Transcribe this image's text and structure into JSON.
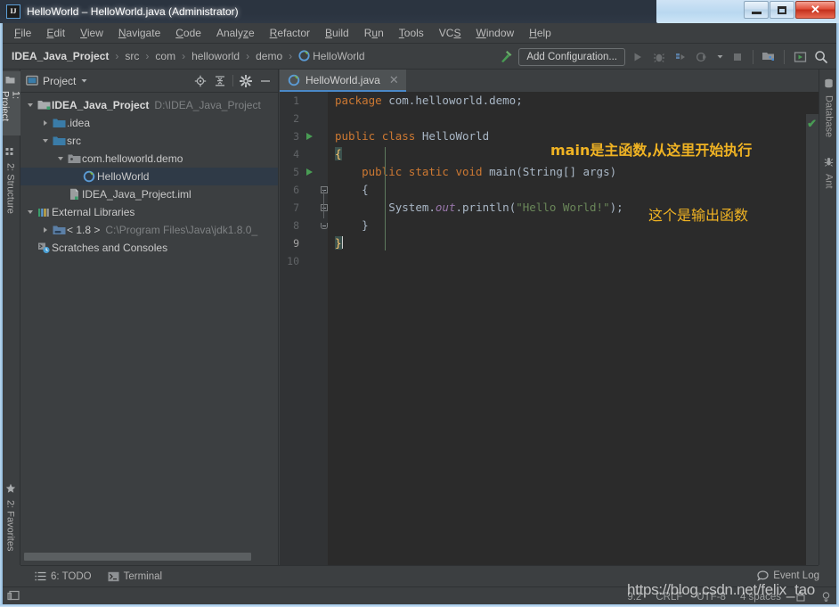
{
  "window": {
    "title": "HelloWorld – HelloWorld.java (Administrator)",
    "logo": "ij-logo",
    "minimize": "minimize-icon",
    "maximize": "maximize-icon",
    "close": "✕"
  },
  "menubar": {
    "items": [
      {
        "label": "File",
        "mnemonic": "F"
      },
      {
        "label": "Edit",
        "mnemonic": "E"
      },
      {
        "label": "View",
        "mnemonic": "V"
      },
      {
        "label": "Navigate",
        "mnemonic": "N"
      },
      {
        "label": "Code",
        "mnemonic": "C"
      },
      {
        "label": "Analyze",
        "mnemonic": "z"
      },
      {
        "label": "Refactor",
        "mnemonic": "R"
      },
      {
        "label": "Build",
        "mnemonic": "B"
      },
      {
        "label": "Run",
        "mnemonic": "u"
      },
      {
        "label": "Tools",
        "mnemonic": "T"
      },
      {
        "label": "VCS",
        "mnemonic": "S"
      },
      {
        "label": "Window",
        "mnemonic": "W"
      },
      {
        "label": "Help",
        "mnemonic": "H"
      }
    ]
  },
  "navbar": {
    "crumbs": [
      {
        "label": "IDEA_Java_Project"
      },
      {
        "label": "src"
      },
      {
        "label": "com"
      },
      {
        "label": "helloworld"
      },
      {
        "label": "demo"
      },
      {
        "label": "HelloWorld"
      }
    ],
    "separator": "›",
    "run_config_label": "Add Configuration...",
    "buttons": [
      "build-hammer-icon",
      "run-icon",
      "debug-icon",
      "run-with-coverage-icon",
      "profile-icon",
      "dropdown-icon",
      "stop-icon",
      "project-structure-icon",
      "update-icon",
      "search-everywhere-icon"
    ]
  },
  "left_strip": {
    "items": [
      {
        "label": "1: Project",
        "icon": "project-icon",
        "active": true
      },
      {
        "label": "2: Structure",
        "icon": "structure-icon",
        "active": false
      },
      {
        "label": "2: Favorites",
        "icon": "star-icon",
        "active": false
      }
    ],
    "bottom_icon": "toggle-toolwindows-icon"
  },
  "right_strip": {
    "items": [
      {
        "label": "Database",
        "icon": "database-icon"
      },
      {
        "label": "Ant",
        "icon": "ant-icon"
      }
    ]
  },
  "project_panel": {
    "title": "Project",
    "title_icon": "project-view-icon",
    "dropdown_icon": "chevron-down-icon",
    "actions": [
      "locate-icon",
      "collapse-all-icon",
      "settings-gear-icon",
      "hide-icon"
    ],
    "tree": [
      {
        "indent": 0,
        "arrow": "open",
        "icon": "module-icon",
        "label": "IDEA_Java_Project",
        "bold": true,
        "sub": "D:\\IDEA_Java_Project",
        "selected": false
      },
      {
        "indent": 1,
        "arrow": "closed",
        "icon": "folder-icon",
        "label": ".idea",
        "bold": false,
        "sub": "",
        "selected": false
      },
      {
        "indent": 1,
        "arrow": "open",
        "icon": "source-folder-icon",
        "label": "src",
        "bold": false,
        "sub": "",
        "selected": false
      },
      {
        "indent": 2,
        "arrow": "open",
        "icon": "package-icon",
        "label": "com.helloworld.demo",
        "bold": false,
        "sub": "",
        "selected": false
      },
      {
        "indent": 3,
        "arrow": "none",
        "icon": "java-class-icon",
        "label": "HelloWorld",
        "bold": false,
        "sub": "",
        "selected": true
      },
      {
        "indent": 2,
        "arrow": "none",
        "icon": "iml-file-icon",
        "label": "IDEA_Java_Project.iml",
        "bold": false,
        "sub": "",
        "selected": false
      },
      {
        "indent": 0,
        "arrow": "open",
        "icon": "libraries-icon",
        "label": "External Libraries",
        "bold": false,
        "sub": "",
        "selected": false
      },
      {
        "indent": 1,
        "arrow": "closed",
        "icon": "jdk-icon",
        "label": "< 1.8 >",
        "bold": false,
        "sub": "C:\\Program Files\\Java\\jdk1.8.0_",
        "selected": false
      },
      {
        "indent": 0,
        "arrow": "none",
        "icon": "scratches-icon",
        "label": "Scratches and Consoles",
        "bold": false,
        "sub": "",
        "selected": false
      }
    ]
  },
  "editor": {
    "tab": {
      "label": "HelloWorld.java",
      "icon": "java-class-icon",
      "close": "✕"
    },
    "status_check": "✔",
    "lines": [
      {
        "n": "1",
        "run": false,
        "text": "package com.helloworld.demo;"
      },
      {
        "n": "2",
        "run": false,
        "text": ""
      },
      {
        "n": "3",
        "run": true,
        "text": "public class HelloWorld"
      },
      {
        "n": "4",
        "run": false,
        "text": "{"
      },
      {
        "n": "5",
        "run": true,
        "text": "    public static void main(String[] args)"
      },
      {
        "n": "6",
        "run": false,
        "text": "    {"
      },
      {
        "n": "7",
        "run": false,
        "text": "        System.out.println(\"Hello World!\");"
      },
      {
        "n": "8",
        "run": false,
        "text": "    }"
      },
      {
        "n": "9",
        "run": false,
        "text": "}"
      },
      {
        "n": "10",
        "run": false,
        "text": ""
      }
    ],
    "annotations": [
      {
        "text": "main是主函数,从这里开始执行",
        "name": "annotation-main"
      },
      {
        "text": "这个是输出函数",
        "name": "annotation-println"
      }
    ]
  },
  "bottom_strip": {
    "items": [
      {
        "label": "6: TODO",
        "icon": "todo-list-icon"
      },
      {
        "label": "Terminal",
        "icon": "terminal-icon"
      }
    ]
  },
  "statusbar": {
    "event_log": "Event Log",
    "event_log_icon": "balloon-icon",
    "toggle_icon": "toggle-toolwindows-icon",
    "caret_position": "9:2",
    "line_separator": "CRLF",
    "encoding": "UTF-8",
    "indent": "4 spaces",
    "lock_icon": "read-only-icon",
    "inspection_icon": "inspection-icon"
  },
  "watermark": {
    "text": "https://blog.csdn.net/felix_tao"
  },
  "colors": {
    "accent": "#4a88c7",
    "annotation": "#f0b323",
    "keyword": "#cc7832",
    "string": "#6a8759",
    "field": "#9876aa",
    "default_text": "#a9b7c6",
    "editor_bg": "#2b2b2b",
    "panel_bg": "#3c3f41",
    "selection": "#2f3a47",
    "run_green": "#499c54"
  }
}
